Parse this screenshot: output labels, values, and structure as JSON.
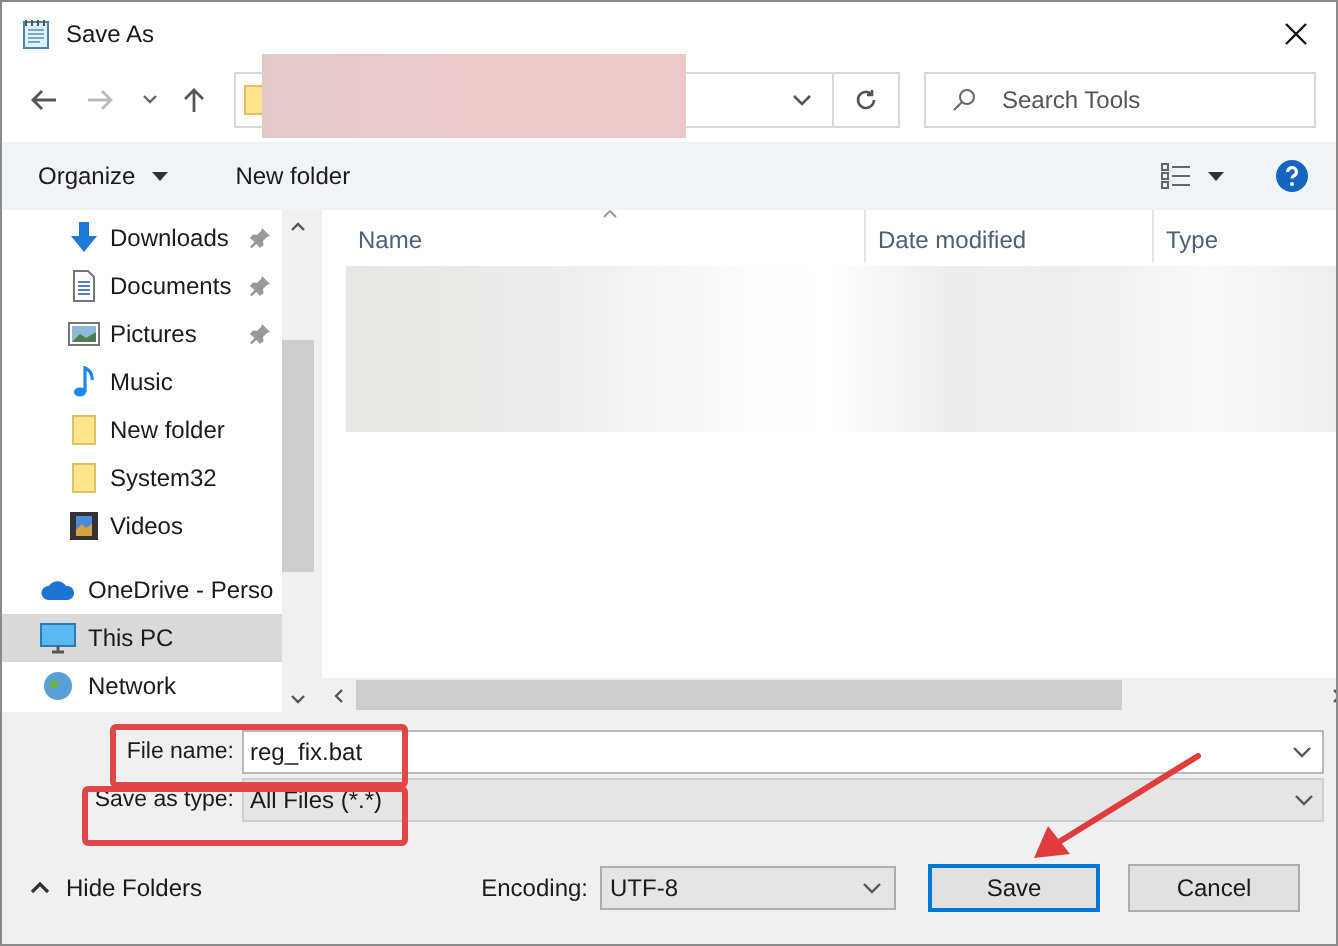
{
  "window": {
    "title": "Save As"
  },
  "navigation": {
    "search": {
      "placeholder": "Search Tools"
    }
  },
  "toolbar": {
    "items": [
      "Organize",
      "New folder"
    ]
  },
  "sidebar": {
    "quick_access": [
      {
        "label": "Downloads",
        "kind": "download",
        "pinned": true
      },
      {
        "label": "Documents",
        "kind": "document",
        "pinned": true
      },
      {
        "label": "Pictures",
        "kind": "pictures",
        "pinned": true
      },
      {
        "label": "Music",
        "kind": "music",
        "pinned": false
      },
      {
        "label": "New folder",
        "kind": "folder",
        "pinned": false
      },
      {
        "label": "System32",
        "kind": "folder",
        "pinned": false
      },
      {
        "label": "Videos",
        "kind": "videos",
        "pinned": false
      }
    ],
    "locations": [
      {
        "label": "OneDrive - Perso",
        "kind": "cloud",
        "selected": false
      },
      {
        "label": "This PC",
        "kind": "pc",
        "selected": true
      },
      {
        "label": "Network",
        "kind": "network",
        "selected": false
      }
    ]
  },
  "file_list": {
    "columns": [
      "Name",
      "Date modified",
      "Type"
    ]
  },
  "form": {
    "file_name": {
      "label": "File name:",
      "value": "reg_fix.bat"
    },
    "save_as_type": {
      "label": "Save as type:",
      "value": "All Files  (*.*)"
    }
  },
  "footer": {
    "hide_folders": "Hide Folders",
    "encoding": {
      "label": "Encoding:",
      "value": "UTF-8"
    },
    "buttons": [
      {
        "label": "Save",
        "default": true
      },
      {
        "label": "Cancel",
        "default": false
      }
    ]
  }
}
